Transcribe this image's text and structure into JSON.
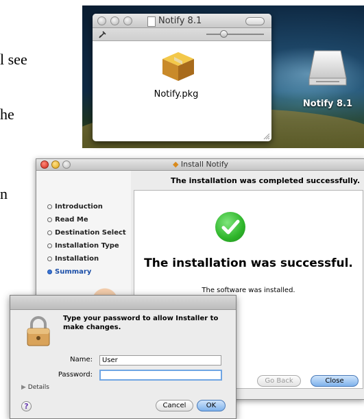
{
  "doc": {
    "frag1": "l see",
    "frag2": "he",
    "frag3": "n"
  },
  "finder": {
    "title": "Notify 8.1",
    "file_label": "Notify.pkg"
  },
  "desktop": {
    "drive_label": "Notify 8.1"
  },
  "installer": {
    "title": "Install Notify",
    "headline": "The installation was completed successfully.",
    "steps": [
      "Introduction",
      "Read Me",
      "Destination Select",
      "Installation Type",
      "Installation",
      "Summary"
    ],
    "active_step": "Summary",
    "success_title": "The installation was successful.",
    "success_detail": "The software was installed.",
    "go_back_label": "Go Back",
    "close_label": "Close"
  },
  "auth": {
    "message": "Type your password to allow Installer to make changes.",
    "name_label": "Name:",
    "name_value": "User",
    "password_label": "Password:",
    "password_value": "",
    "details_label": "Details",
    "help_label": "?",
    "cancel_label": "Cancel",
    "ok_label": "OK"
  },
  "colors": {
    "accent_blue": "#3b76d6",
    "success_green": "#2eb52a"
  }
}
